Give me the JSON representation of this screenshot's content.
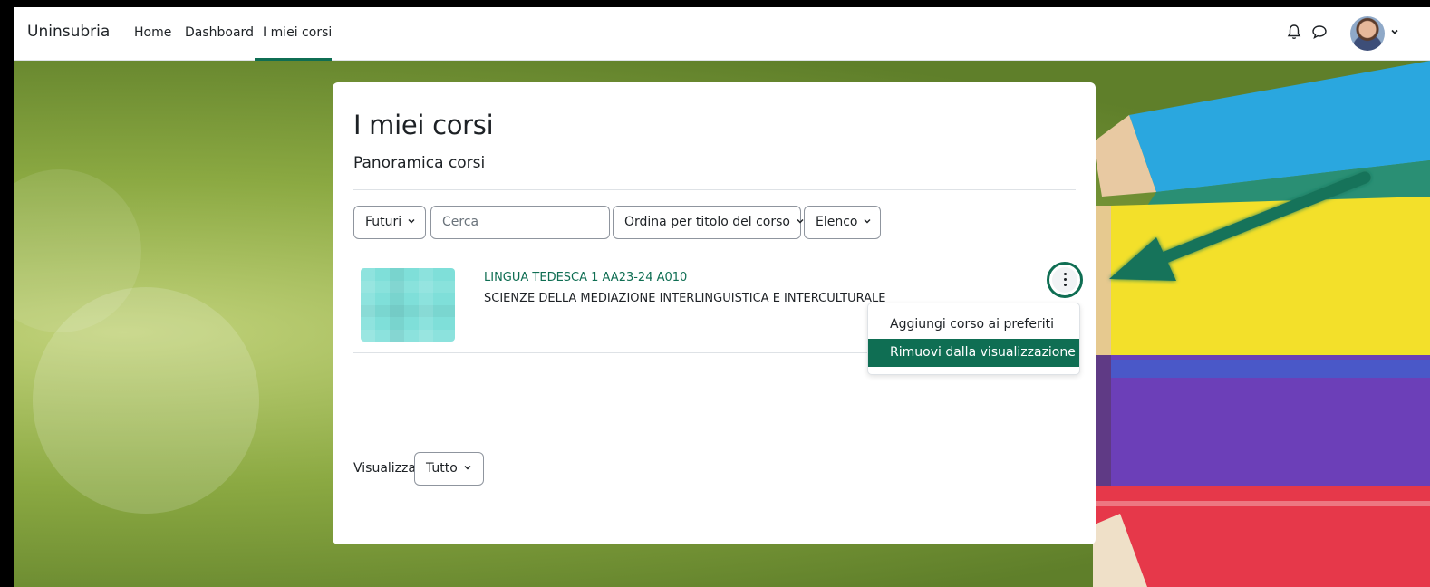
{
  "navbar": {
    "brand": "Uninsubria",
    "links": [
      "Home",
      "Dashboard",
      "I miei corsi"
    ],
    "active_link": "I miei corsi"
  },
  "icons": {
    "notifications": "bell-icon",
    "messages": "chat-icon",
    "user_menu_caret": "chevron-down-icon",
    "course_actions": "kebab-menu-icon"
  },
  "main": {
    "title": "I miei corsi",
    "section_title": "Panoramica corsi",
    "filters": {
      "grouping": "Futuri",
      "search_placeholder": "Cerca",
      "sort": "Ordina per titolo del corso",
      "view": "Elenco"
    },
    "courses": [
      {
        "name": "LINGUA TEDESCA 1 AA23-24 A010",
        "category": "SCIENZE DELLA MEDIAZIONE INTERLINGUISTICA E INTERCULTURALE"
      }
    ],
    "course_menu": {
      "items": [
        "Aggiungi corso ai preferiti",
        "Rimuovi dalla visualizzazione"
      ],
      "highlighted": "Rimuovi dalla visualizzazione"
    },
    "paging": {
      "label": "Visualizza",
      "value": "Tutto"
    }
  },
  "colors": {
    "accent": "#0f6e53",
    "arrow": "#14735a",
    "text": "#1d2125",
    "course_image": "#7fdfd9"
  }
}
